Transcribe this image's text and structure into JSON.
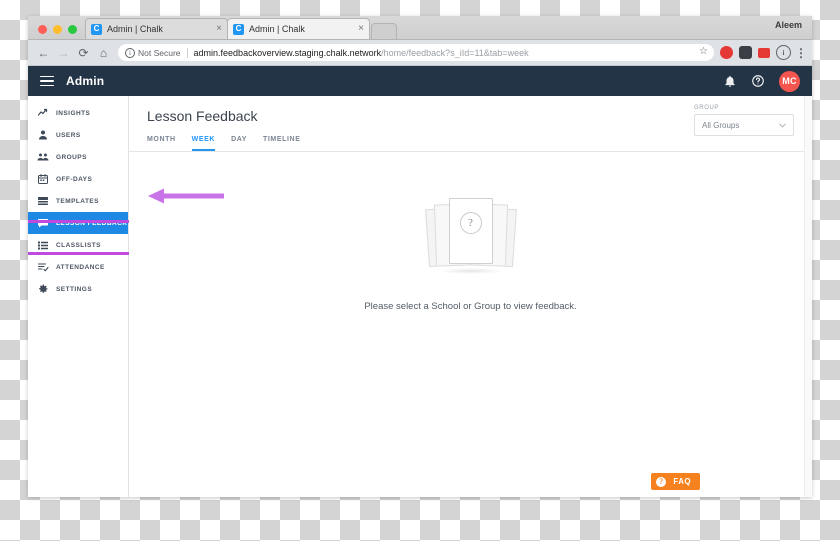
{
  "browser": {
    "user_label": "Aleem",
    "tabs": [
      {
        "favicon": "chalk-favicon",
        "title": "Admin | Chalk",
        "close": "×"
      },
      {
        "favicon": "chalk-favicon",
        "title": "Admin | Chalk",
        "close": "×"
      }
    ],
    "nav": {
      "back": "←",
      "forward": "→",
      "reload": "⟳",
      "home": "⌂"
    },
    "omnibox": {
      "security_text": "Not Secure",
      "security_glyph": "i",
      "url_domain": "admin.feedbackoverview.staging.chalk.network",
      "url_path": "/home/feedback?s_iId=11&tab=week",
      "star": "☆"
    },
    "extensions": [
      "adblock-icon",
      "pocket-icon",
      "extension-icon",
      "info-icon",
      "kebab-menu-icon"
    ],
    "ext_glyphs": {
      "adb": "ABP",
      "pocket": "▼",
      "info": "i",
      "kebab": "⋮"
    }
  },
  "appbar": {
    "menu_icon": "hamburger-menu-icon",
    "title": "Admin",
    "notification_icon": "☐",
    "help_icon": "?",
    "avatar_initials": "MC",
    "avatar_color": "#f4564f"
  },
  "sidebar": {
    "items": [
      {
        "label": "Insights",
        "icon": "insights-icon",
        "active": false
      },
      {
        "label": "Users",
        "icon": "users-icon",
        "active": false
      },
      {
        "label": "Groups",
        "icon": "groups-icon",
        "active": false
      },
      {
        "label": "Off-Days",
        "icon": "calendar-icon",
        "active": false
      },
      {
        "label": "Templates",
        "icon": "templates-icon",
        "active": false
      },
      {
        "label": "Lesson Feedback",
        "icon": "lesson-feedback-icon",
        "active": true
      },
      {
        "label": "Classlists",
        "icon": "classlists-icon",
        "active": false
      },
      {
        "label": "Attendance",
        "icon": "attendance-icon",
        "active": false
      },
      {
        "label": "Settings",
        "icon": "settings-gear-icon",
        "active": false
      }
    ],
    "active_color": "#1e88e5"
  },
  "annotation": {
    "color": "#c04ae0",
    "box_target": "Lesson Feedback",
    "arrow_direction": "left"
  },
  "main": {
    "title": "Lesson Feedback",
    "tabs": [
      {
        "label": "Month",
        "active": false
      },
      {
        "label": "Week",
        "active": true
      },
      {
        "label": "Day",
        "active": false
      },
      {
        "label": "Timeline",
        "active": false
      }
    ],
    "accent_color": "#2196f3",
    "group_picker": {
      "label": "Group",
      "value": "All Groups",
      "caret": "⌄"
    },
    "empty_state": {
      "illustration": "stacked-documents-question-icon",
      "question_glyph": "?",
      "message": "Please select a School or Group to view feedback."
    },
    "faq_button": {
      "label": "FAQ",
      "glyph": "?",
      "color": "#f5821f"
    }
  }
}
